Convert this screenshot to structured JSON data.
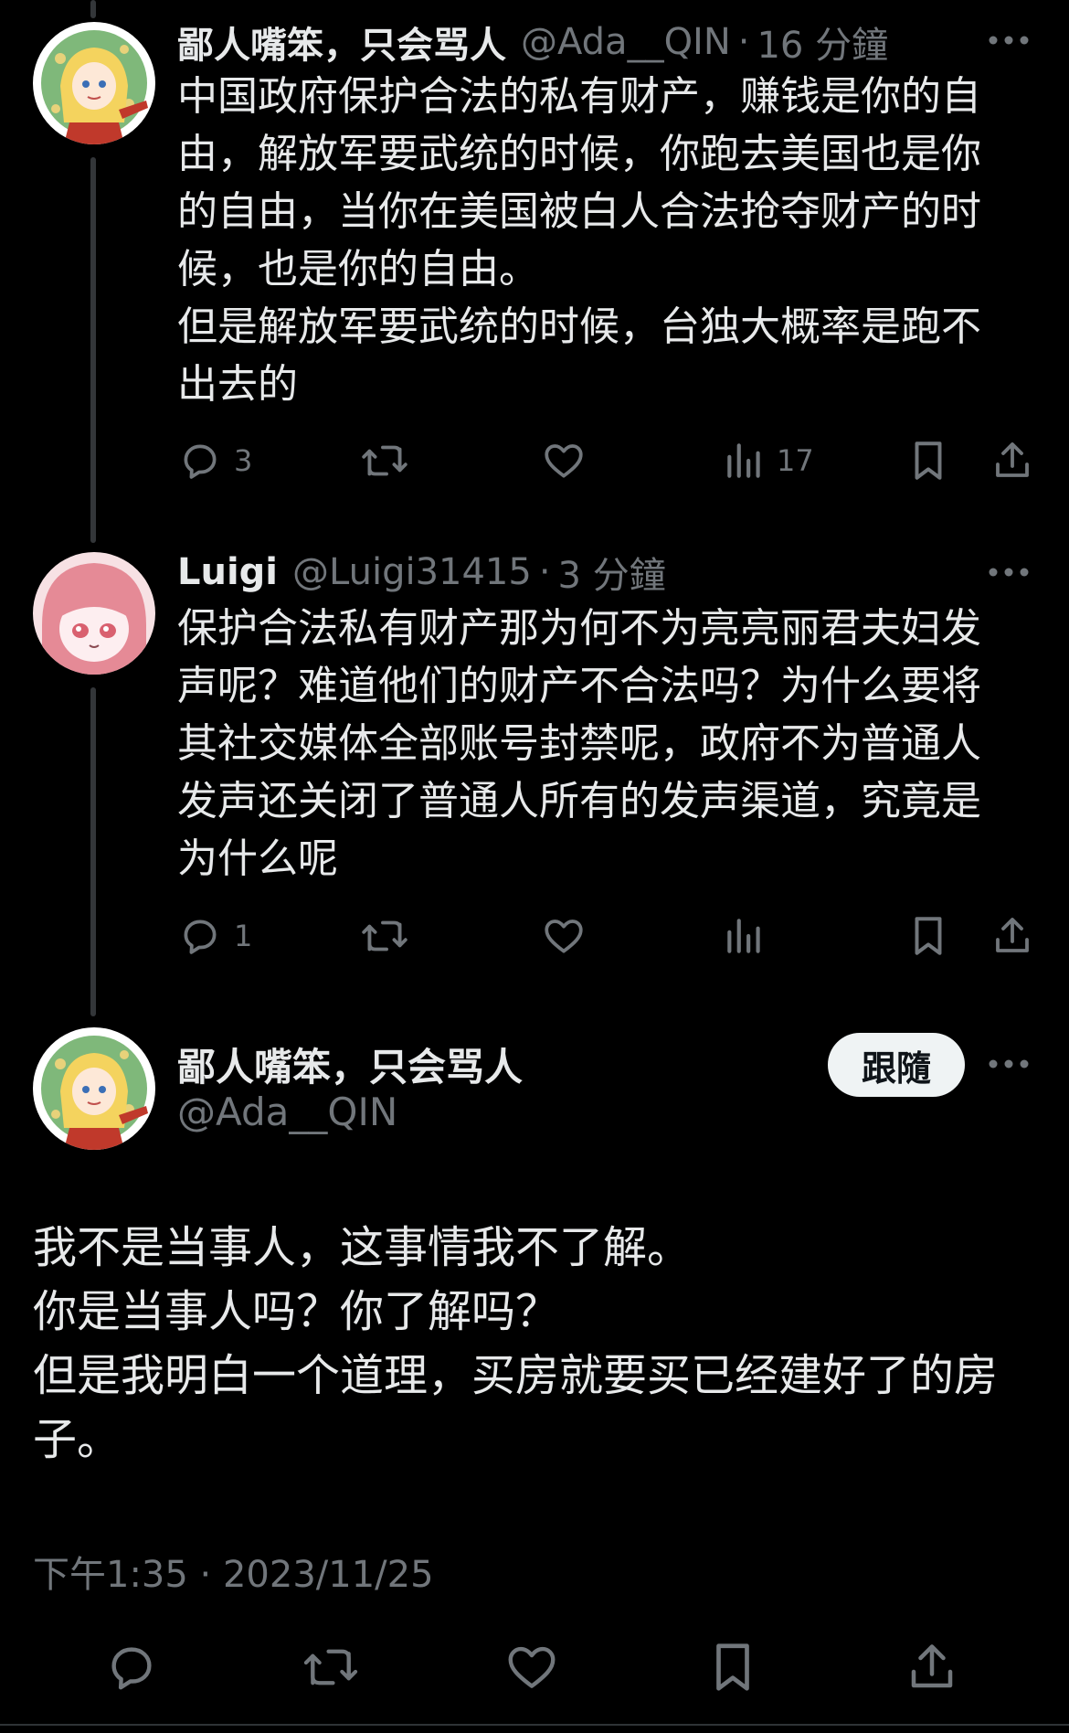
{
  "tweets": [
    {
      "display_name": "鄙人嘴笨，只会骂人",
      "handle": "@Ada__QIN",
      "separator": "·",
      "time": "16 分鐘",
      "avatar_icon": "anime-girl-blonde-avatar",
      "text_lines": [
        "中国政府保护合法的私有财产，赚钱是你的自由，解放军要武统的时候，你跑去美国也是你的自由，当你在美国被白人合法抢夺财产的时候，也是你的自由。",
        "但是解放军要武统的时候，台独大概率是跑不出去的"
      ],
      "replies": "3",
      "views": "17"
    },
    {
      "display_name": "Luigi",
      "handle": "@Luigi31415",
      "separator": "·",
      "time": "3 分鐘",
      "avatar_icon": "anime-girl-pink-avatar",
      "text_lines": [
        "保护合法私有财产那为何不为亮亮丽君夫妇发声呢？难道他们的财产不合法吗？为什么要将其社交媒体全部账号封禁呢，政府不为普通人发声还关闭了普通人所有的发声渠道，究竟是为什么呢"
      ],
      "replies": "1",
      "views": ""
    }
  ],
  "main_tweet": {
    "display_name": "鄙人嘴笨，只会骂人",
    "handle": "@Ada__QIN",
    "follow_label": "跟隨",
    "text_lines": [
      "我不是当事人，这事情我不了解。",
      "你是当事人吗？你了解吗？",
      "但是我明白一个道理，买房就要买已经建好了的房子。"
    ],
    "timestamp": "下午1:35 · 2023/11/25"
  },
  "colors": {
    "background": "#000000",
    "text": "#e7e9ea",
    "muted": "#71767b",
    "thread_line": "#333639",
    "follow_bg": "#eff3f4"
  }
}
